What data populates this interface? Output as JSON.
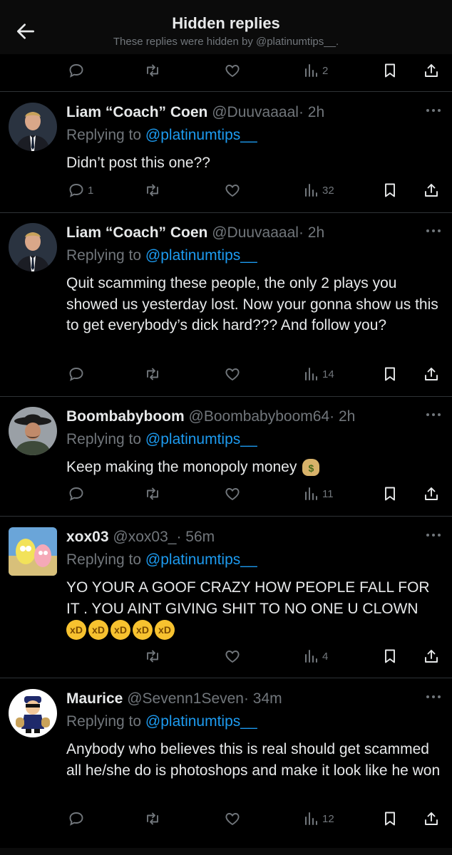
{
  "header": {
    "title": "Hidden replies",
    "subtitle": "These replies were hidden by @platinumtips__."
  },
  "top_actions": {
    "views": "2"
  },
  "tweets": [
    {
      "name": "Liam “Coach” Coen",
      "handle": "@Duuvaaaal",
      "time": "· 2h",
      "replying_label": "Replying to",
      "replying_to": "@platinumtips__",
      "text": "Didn’t post this one??",
      "replies": "1",
      "views": "32",
      "avatar": "man-in-suit-avatar"
    },
    {
      "name": "Liam “Coach” Coen",
      "handle": "@Duuvaaaal",
      "time": "· 2h",
      "replying_label": "Replying to",
      "replying_to": "@platinumtips__",
      "text": "Quit scamming these people, the only 2 plays you showed us yesterday lost. Now your gonna show us this to get everybody’s dick hard??? And follow you?",
      "replies": "",
      "views": "14",
      "avatar": "man-in-suit-avatar"
    },
    {
      "name": "Boombabyboom",
      "handle": "@Boombabyboom64",
      "time": "· 2h",
      "replying_label": "Replying to",
      "replying_to": "@platinumtips__",
      "text": "Keep making the monopoly money",
      "emoji": "money-bag-emoji",
      "replies": "",
      "views": "11",
      "avatar": "cowboy-hat-avatar"
    },
    {
      "name": "xox03",
      "handle": "@xox03_",
      "time": "· 56m",
      "replying_label": "Replying to",
      "replying_to": "@platinumtips__",
      "text": "YO YOUR A GOOF  CRAZY HOW PEOPLE FALL FOR IT . YOU AINT GIVING SHIT TO NO ONE U CLOWN",
      "emojis": [
        "rofl-emoji",
        "rofl-emoji",
        "rofl-emoji",
        "rofl-emoji",
        "rofl-emoji"
      ],
      "replies": "",
      "views": "4",
      "avatar": "cartoon-avatar"
    },
    {
      "name": "Maurice",
      "handle": "@Sevenn1Seven",
      "time": "· 34m",
      "replying_label": "Replying to",
      "replying_to": "@platinumtips__",
      "text": "Anybody who believes this is real should get scammed all he/she do is photoshops and make it look like he won",
      "replies": "",
      "views": "12",
      "avatar": "robber-emoji-avatar"
    }
  ],
  "colors": {
    "background": "#000000",
    "text": "#e7e9ea",
    "muted": "#71767b",
    "link": "#1d9bf0",
    "divider": "#2f3336"
  }
}
